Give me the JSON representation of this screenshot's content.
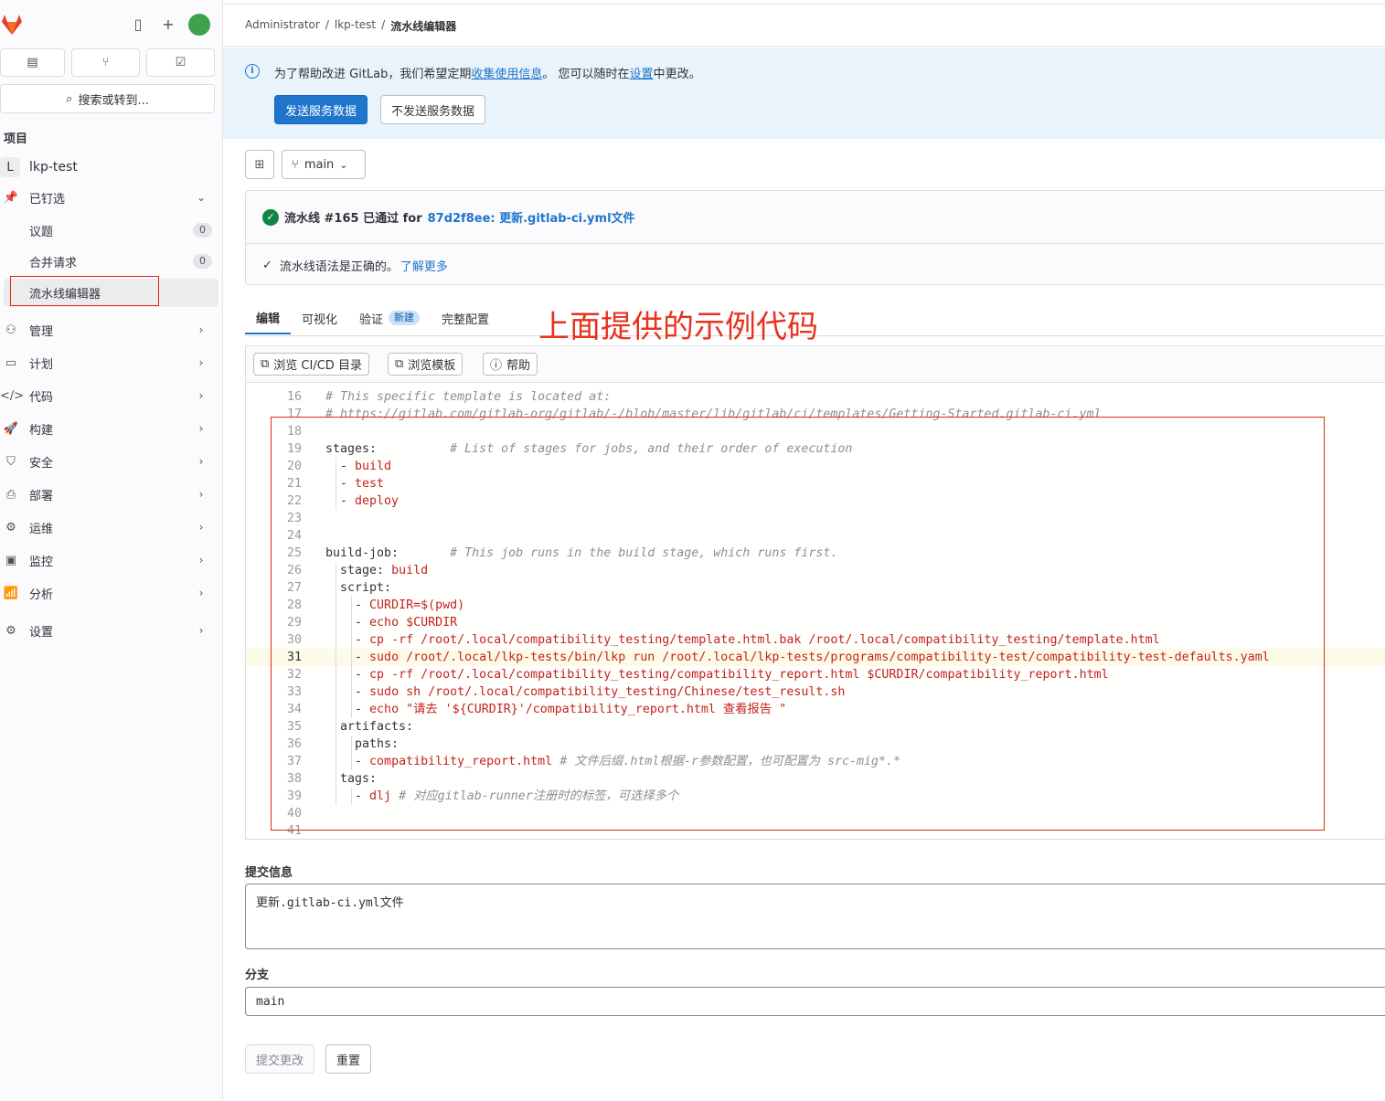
{
  "sidebar": {
    "search_label": "搜索或转到...",
    "section_title": "项目",
    "project": {
      "badge": "L",
      "name": "lkp-test"
    },
    "pinned": {
      "label": "已钉选",
      "items": [
        {
          "label": "议题",
          "count": "0"
        },
        {
          "label": "合并请求",
          "count": "0"
        },
        {
          "label": "流水线编辑器",
          "count": ""
        }
      ]
    },
    "nav": [
      {
        "label": "管理",
        "icon": "users-icon"
      },
      {
        "label": "计划",
        "icon": "planning-icon"
      },
      {
        "label": "代码",
        "icon": "code-icon"
      },
      {
        "label": "构建",
        "icon": "rocket-icon"
      },
      {
        "label": "安全",
        "icon": "shield-icon"
      },
      {
        "label": "部署",
        "icon": "deployments-icon"
      },
      {
        "label": "运维",
        "icon": "cloud-gear-icon"
      },
      {
        "label": "监控",
        "icon": "monitor-icon"
      },
      {
        "label": "分析",
        "icon": "chart-icon"
      },
      {
        "label": "设置",
        "icon": "gear-icon"
      }
    ]
  },
  "breadcrumb": [
    "Administrator",
    "lkp-test",
    "流水线编辑器"
  ],
  "banner": {
    "text_before": "为了帮助改进 GitLab，我们希望定期",
    "link1": "收集使用信息",
    "text_mid": "。 您可以随时在",
    "link2": "设置",
    "text_after": "中更改。",
    "primary_button": "发送服务数据",
    "secondary_button": "不发送服务数据"
  },
  "branch_selector": "main",
  "pipeline_status": {
    "text": "流水线 #165 已通过 for",
    "link": "87d2f8ee: 更新.gitlab-ci.yml文件",
    "lint_text": "流水线语法是正确的。",
    "lint_link": "了解更多"
  },
  "tabs": [
    {
      "label": "编辑",
      "badge": ""
    },
    {
      "label": "可视化",
      "badge": ""
    },
    {
      "label": "验证",
      "badge": "新建"
    },
    {
      "label": "完整配置",
      "badge": ""
    }
  ],
  "annotation": "上面提供的示例代码",
  "toolbar": {
    "browse_cicd": "浏览 CI/CD 目录",
    "browse_templates": "浏览模板",
    "help": "帮助"
  },
  "code_lines": [
    {
      "n": "16",
      "parts": [
        [
          "c",
          "# This specific template is located at:"
        ]
      ]
    },
    {
      "n": "17",
      "parts": [
        [
          "c",
          "# https://gitlab.com/gitlab-org/gitlab/-/blob/master/lib/gitlab/ci/templates/Getting-Started.gitlab-ci.yml"
        ]
      ]
    },
    {
      "n": "18",
      "parts": []
    },
    {
      "n": "19",
      "parts": [
        [
          "k",
          "stages:          "
        ],
        [
          "c",
          "# List of stages for jobs, and their order of execution"
        ]
      ]
    },
    {
      "n": "20",
      "parts": [
        [
          "k",
          "  - "
        ],
        [
          "s",
          "build"
        ]
      ]
    },
    {
      "n": "21",
      "parts": [
        [
          "k",
          "  - "
        ],
        [
          "s",
          "test"
        ]
      ]
    },
    {
      "n": "22",
      "parts": [
        [
          "k",
          "  - "
        ],
        [
          "s",
          "deploy"
        ]
      ]
    },
    {
      "n": "23",
      "parts": []
    },
    {
      "n": "24",
      "parts": []
    },
    {
      "n": "25",
      "parts": [
        [
          "k",
          "build-job:       "
        ],
        [
          "c",
          "# This job runs in the build stage, which runs first."
        ]
      ]
    },
    {
      "n": "26",
      "parts": [
        [
          "k",
          "  stage: "
        ],
        [
          "s",
          "build"
        ]
      ]
    },
    {
      "n": "27",
      "parts": [
        [
          "k",
          "  script:"
        ]
      ]
    },
    {
      "n": "28",
      "parts": [
        [
          "k",
          "    - "
        ],
        [
          "s",
          "CURDIR=$(pwd)"
        ]
      ]
    },
    {
      "n": "29",
      "parts": [
        [
          "k",
          "    - "
        ],
        [
          "s",
          "echo $CURDIR"
        ]
      ]
    },
    {
      "n": "30",
      "parts": [
        [
          "k",
          "    - "
        ],
        [
          "s",
          "cp -rf /root/.local/compatibility_testing/template.html.bak /root/.local/compatibility_testing/template.html"
        ]
      ]
    },
    {
      "n": "31",
      "parts": [
        [
          "k",
          "    - "
        ],
        [
          "s",
          "sudo /root/.local/lkp-tests/bin/lkp run /root/.local/lkp-tests/programs/compatibility-test/compatibility-test-defaults.yaml"
        ]
      ]
    },
    {
      "n": "32",
      "parts": [
        [
          "k",
          "    - "
        ],
        [
          "s",
          "cp -rf /root/.local/compatibility_testing/compatibility_report.html $CURDIR/compatibility_report.html"
        ]
      ]
    },
    {
      "n": "33",
      "parts": [
        [
          "k",
          "    - "
        ],
        [
          "s",
          "sudo sh /root/.local/compatibility_testing/Chinese/test_result.sh"
        ]
      ]
    },
    {
      "n": "34",
      "parts": [
        [
          "k",
          "    - "
        ],
        [
          "s",
          "echo \"请去 '${CURDIR}'/compatibility_report.html 查看报告 \""
        ]
      ]
    },
    {
      "n": "35",
      "parts": [
        [
          "k",
          "  artifacts:"
        ]
      ]
    },
    {
      "n": "36",
      "parts": [
        [
          "k",
          "    paths:"
        ]
      ]
    },
    {
      "n": "37",
      "parts": [
        [
          "k",
          "    - "
        ],
        [
          "s",
          "compatibility_report.html "
        ],
        [
          "c",
          "# 文件后缀.html根据-r参数配置，也可配置为 src-mig*.*"
        ]
      ]
    },
    {
      "n": "38",
      "parts": [
        [
          "k",
          "  tags:"
        ]
      ]
    },
    {
      "n": "39",
      "parts": [
        [
          "k",
          "    - "
        ],
        [
          "s",
          "dlj "
        ],
        [
          "c",
          "# 对应gitlab-runner注册时的标签，可选择多个"
        ]
      ]
    },
    {
      "n": "40",
      "parts": []
    },
    {
      "n": "41",
      "parts": []
    }
  ],
  "highlight_line": "31",
  "form": {
    "commit_label": "提交信息",
    "commit_value": "更新.gitlab-ci.yml文件",
    "branch_label": "分支",
    "branch_value": "main",
    "submit_button": "提交更改",
    "reset_button": "重置"
  },
  "colors": {
    "accent": "#1f75cb",
    "success": "#108548",
    "annotation_red": "#dd2b0e"
  }
}
